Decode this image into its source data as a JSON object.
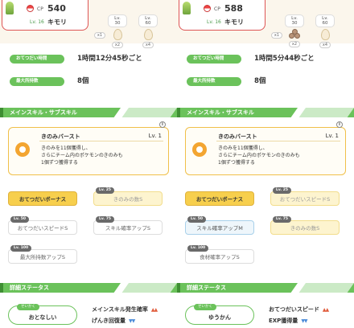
{
  "colors": {
    "green": "#6bc25b",
    "gold": "#f7cf4d",
    "bg": "#fbf6ec"
  },
  "panels": [
    {
      "cp_label": "CP",
      "cp": "540",
      "level": "Lv. 16",
      "name": "キモリ",
      "slots": [
        {
          "lv": "Lv. 30",
          "x": "",
          "kind": "egg"
        },
        {
          "lv": "Lv. 60",
          "x": "x4",
          "kind": "egg"
        }
      ],
      "left_slot_x": "x1",
      "mid_slot_x": "x2",
      "help_interval_label": "おてつだい時間",
      "help_interval": "1時間12分45秒ごと",
      "max_items_label": "最大所持数",
      "max_items": "8個",
      "section_skills": "メインスキル・サブスキル",
      "main_skill": {
        "name": "きのみバースト",
        "level": "Lv. 1",
        "desc1": "きのみを11個獲得し、",
        "desc2": "さらにチーム内のポケモンのきのみも",
        "desc3": "1個ずつ獲得する"
      },
      "subskills": [
        {
          "lv": "",
          "name": "おてつだいボーナス",
          "style": "active"
        },
        {
          "lv": "Lv. 25",
          "name": "きのみの数S",
          "style": "gold"
        },
        {
          "lv": "Lv. 50",
          "name": "おてつだいスピードS",
          "style": "plain"
        },
        {
          "lv": "Lv. 75",
          "name": "スキル確率アップS",
          "style": "plain"
        },
        {
          "lv": "Lv. 100",
          "name": "最大所持数アップS",
          "style": "plain"
        }
      ],
      "section_details": "詳細ステータス",
      "nature_tag": "せいかく",
      "nature": "おとなしい",
      "effect_up": "メインスキル発生確率",
      "effect_down": "げんき回復量"
    },
    {
      "cp_label": "CP",
      "cp": "588",
      "level": "Lv. 16",
      "name": "キモリ",
      "slots": [
        {
          "lv": "Lv. 30",
          "x": "",
          "kind": "nuts"
        },
        {
          "lv": "Lv. 60",
          "x": "x4",
          "kind": "egg"
        }
      ],
      "left_slot_x": "x1",
      "mid_slot_x": "x2",
      "help_interval_label": "おてつだい時間",
      "help_interval": "1時間5分44秒ごと",
      "max_items_label": "最大所持数",
      "max_items": "8個",
      "section_skills": "メインスキル・サブスキル",
      "main_skill": {
        "name": "きのみバースト",
        "level": "Lv. 1",
        "desc1": "きのみを11個獲得し、",
        "desc2": "さらにチーム内のポケモンのきのみも",
        "desc3": "1個ずつ獲得する"
      },
      "subskills": [
        {
          "lv": "",
          "name": "おてつだいボーナス",
          "style": "active"
        },
        {
          "lv": "Lv. 25",
          "name": "おてつだいスピードS",
          "style": "gold"
        },
        {
          "lv": "Lv. 50",
          "name": "スキル確率アップM",
          "style": "blue"
        },
        {
          "lv": "Lv. 75",
          "name": "きのみの数S",
          "style": "gold"
        },
        {
          "lv": "Lv. 100",
          "name": "食材確率アップS",
          "style": "plain"
        }
      ],
      "section_details": "詳細ステータス",
      "nature_tag": "せいかく",
      "nature": "ゆうかん",
      "effect_up": "おてつだいスピード",
      "effect_down": "EXP獲得量"
    }
  ]
}
